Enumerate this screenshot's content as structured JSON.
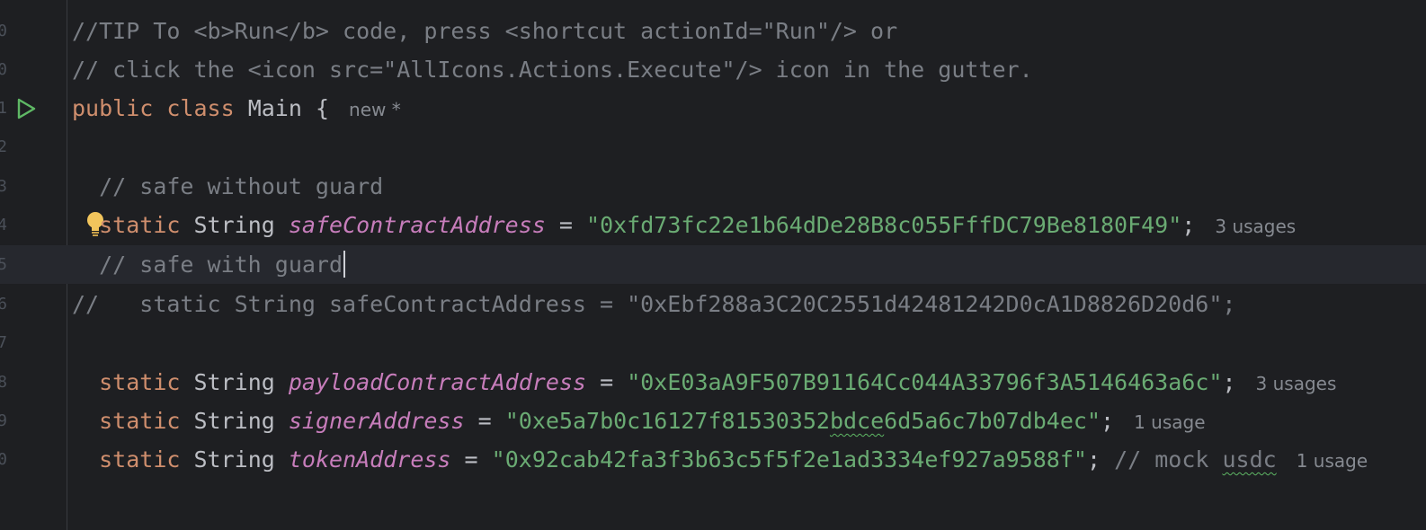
{
  "editor": {
    "line_numbers": [
      "0",
      "0",
      "1",
      "2",
      "3",
      "4",
      "5",
      "6",
      "7",
      "8",
      "9",
      "0"
    ],
    "lines": {
      "l1": {
        "comment": "//TIP To <b>Run</b> code, press <shortcut actionId=\"Run\"/> or"
      },
      "l2": {
        "comment": "// click the <icon src=\"AllIcons.Actions.Execute\"/> icon in the gutter."
      },
      "l3": {
        "kw1": "public",
        "kw2": "class",
        "name": "Main",
        "brace": "{",
        "hint": "new *"
      },
      "l5": {
        "comment": "// safe without guard"
      },
      "l6": {
        "kw": "static",
        "type": "String",
        "field": "safeContractAddress",
        "eq": "=",
        "value": "\"0xfd73fc22e1b64dDe28B8c055FffDC79Be8180F49\"",
        "semi": ";",
        "hint": "3 usages"
      },
      "l7": {
        "comment": "// safe with guard"
      },
      "l8": {
        "comment_prefix": "//",
        "comment": "static String safeContractAddress = \"0xEbf288a3C20C2551d42481242D0cA1D8826D20d6\";"
      },
      "l10": {
        "kw": "static",
        "type": "String",
        "field": "payloadContractAddress",
        "eq": "=",
        "value": "\"0xE03aA9F507B91164Cc044A33796f3A5146463a6c\"",
        "semi": ";",
        "hint": "3 usages"
      },
      "l11": {
        "kw": "static",
        "type": "String",
        "field": "signerAddress",
        "eq": "=",
        "value_a": "\"0xe5a7b0c16127f81530352",
        "value_b": "bdce",
        "value_c": "6d5a6c7b07db4ec\"",
        "semi": ";",
        "hint": "1 usage"
      },
      "l12": {
        "kw": "static",
        "type": "String",
        "field": "tokenAddress",
        "eq": "=",
        "value": "\"0x92cab42fa3f3b63c5f5f2e1ad3334ef927a9588f\"",
        "semi": ";",
        "comment_a": "// mock ",
        "comment_b": "usdc",
        "hint": "1 usage"
      }
    }
  },
  "icons": {
    "run": "run-gutter-icon",
    "intention": "lightbulb-icon"
  },
  "colors": {
    "background": "#1e1f22",
    "keyword": "#cf8e6d",
    "string": "#6aab73",
    "field": "#c77dbb",
    "comment": "#7a7e85",
    "run_icon": "#5fb865",
    "bulb": "#f2c55c"
  }
}
